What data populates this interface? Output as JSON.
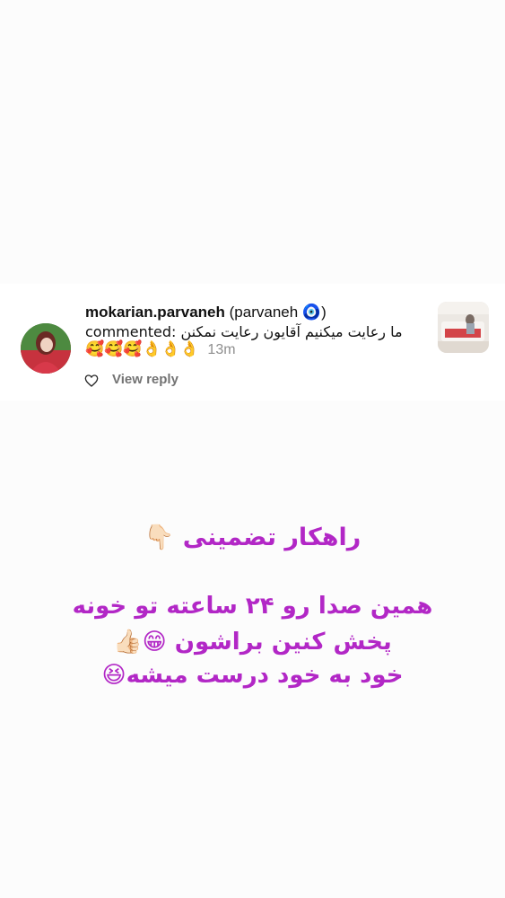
{
  "comment": {
    "username": "mokarian.parvaneh",
    "display_name": "(parvaneh 🧿)",
    "text": "commented: ما رعایت میکنیم آقایون رعایت نمکنن",
    "emojis": "🥰🥰🥰👌👌👌",
    "time": "13m",
    "view_reply": "View reply",
    "icons": {
      "like": "heart-outline-icon"
    }
  },
  "overlay_text": {
    "line1": "راهکار تضمینی 👇🏻",
    "line2": "همین صدا رو ۲۴ ساعته تو خونه",
    "line3": "پخش کنین براشون 😁👍🏻",
    "line4": "خود به خود درست میشه😆"
  },
  "colors": {
    "overlay_text": "#b227c6",
    "muted": "#8e8e8e",
    "background": "#fcfcfc"
  }
}
